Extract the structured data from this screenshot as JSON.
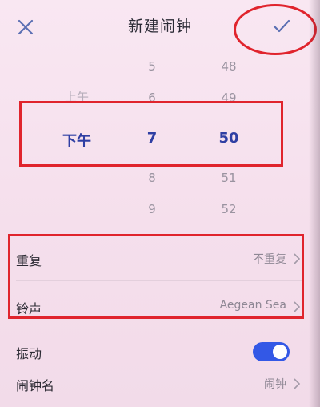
{
  "header": {
    "title": "新建闹钟",
    "close_icon": "close-icon",
    "confirm_icon": "check-icon"
  },
  "picker": {
    "ampm": {
      "above2": "",
      "above1": "上午",
      "selected": "下午",
      "below1": "",
      "below2": ""
    },
    "hour": {
      "above2": "5",
      "above1": "6",
      "selected": "7",
      "below1": "8",
      "below2": "9"
    },
    "minute": {
      "above2": "48",
      "above1": "49",
      "selected": "50",
      "below1": "51",
      "below2": "52"
    }
  },
  "settings": {
    "repeat": {
      "label": "重复",
      "value": "不重复"
    },
    "ringtone": {
      "label": "铃声",
      "value": "Aegean Sea"
    },
    "vibrate": {
      "label": "振动",
      "on": true
    },
    "name": {
      "label": "闹钟名",
      "value": "闹钟"
    }
  },
  "colors": {
    "accent": "#3358e6",
    "selected_text": "#2f3fa3",
    "annotation": "#e0242d",
    "background": "#f6e2ee"
  }
}
